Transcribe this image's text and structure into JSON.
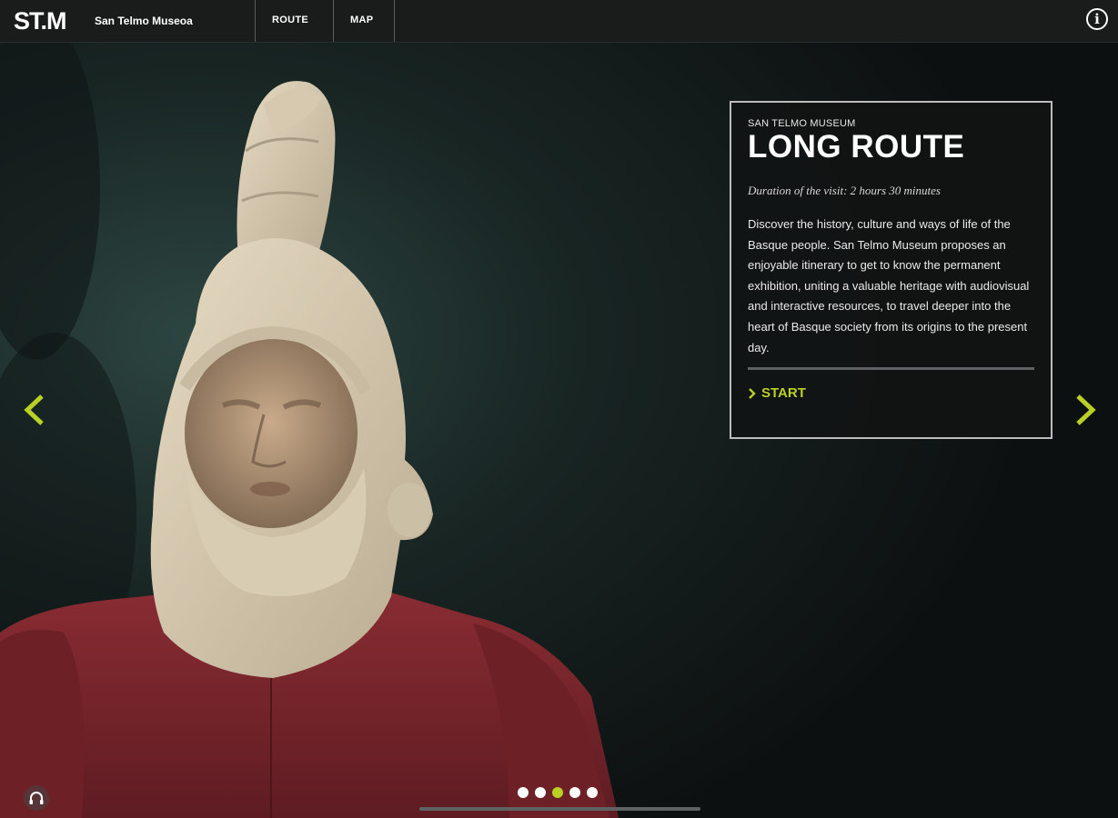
{
  "header": {
    "logo": "ST.M",
    "brand": "San Telmo Museoa",
    "nav": [
      "ROUTE",
      "MAP"
    ],
    "info_icon": "info-icon"
  },
  "card": {
    "eyebrow": "SAN TELMO MUSEUM",
    "title": "LONG ROUTE",
    "duration": "Duration of the visit: 2 hours 30 minutes",
    "description": "Discover the history, culture and ways of life of the Basque people. San Telmo Museum proposes an enjoyable itinerary to get to know the permanent exhibition, uniting a valuable heritage with audiovisual and interactive resources, to travel deeper into the heart of Basque society from its origins to the present day.",
    "start_label": "START"
  },
  "carousel": {
    "slide_count": 5,
    "active_index": 2,
    "accent_color": "#b9d024"
  }
}
